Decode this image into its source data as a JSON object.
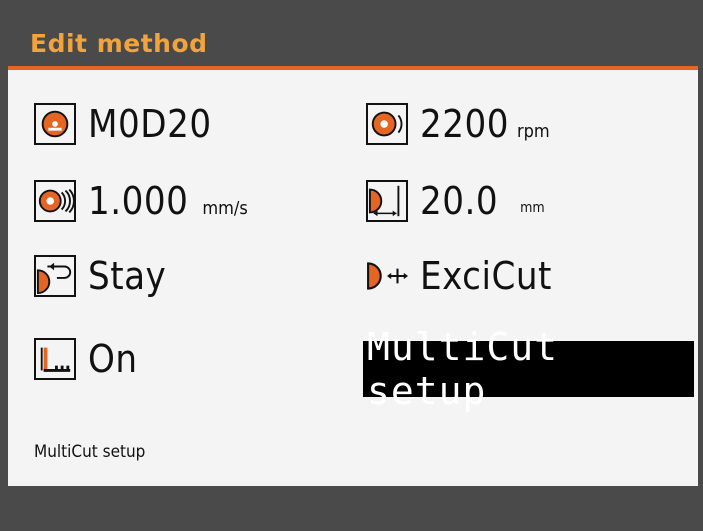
{
  "header": {
    "title": "Edit method"
  },
  "fields": {
    "blade": {
      "icon": "cutoff-wheel-icon",
      "value": "M0D20"
    },
    "speed": {
      "icon": "wheel-rotation-speed-icon",
      "value": "2200",
      "unit": "rpm"
    },
    "feed": {
      "icon": "feed-speed-icon",
      "value": "1.000",
      "unit": "mm/s"
    },
    "length": {
      "icon": "cut-length-icon",
      "value": "20.0",
      "unit": "mm"
    },
    "return": {
      "icon": "return-position-icon",
      "value": "Stay"
    },
    "mode": {
      "icon": "cut-mode-icon",
      "value": "ExciCut"
    },
    "multicut": {
      "icon": "multicut-icon",
      "value": "On"
    },
    "setup": {
      "label": "MultiCut setup"
    }
  },
  "status": {
    "text": "MultiCut setup"
  },
  "colors": {
    "accent": "#e56624",
    "title": "#f3a33b",
    "panel": "#f4f4f4",
    "frame": "#4a4a4a"
  }
}
